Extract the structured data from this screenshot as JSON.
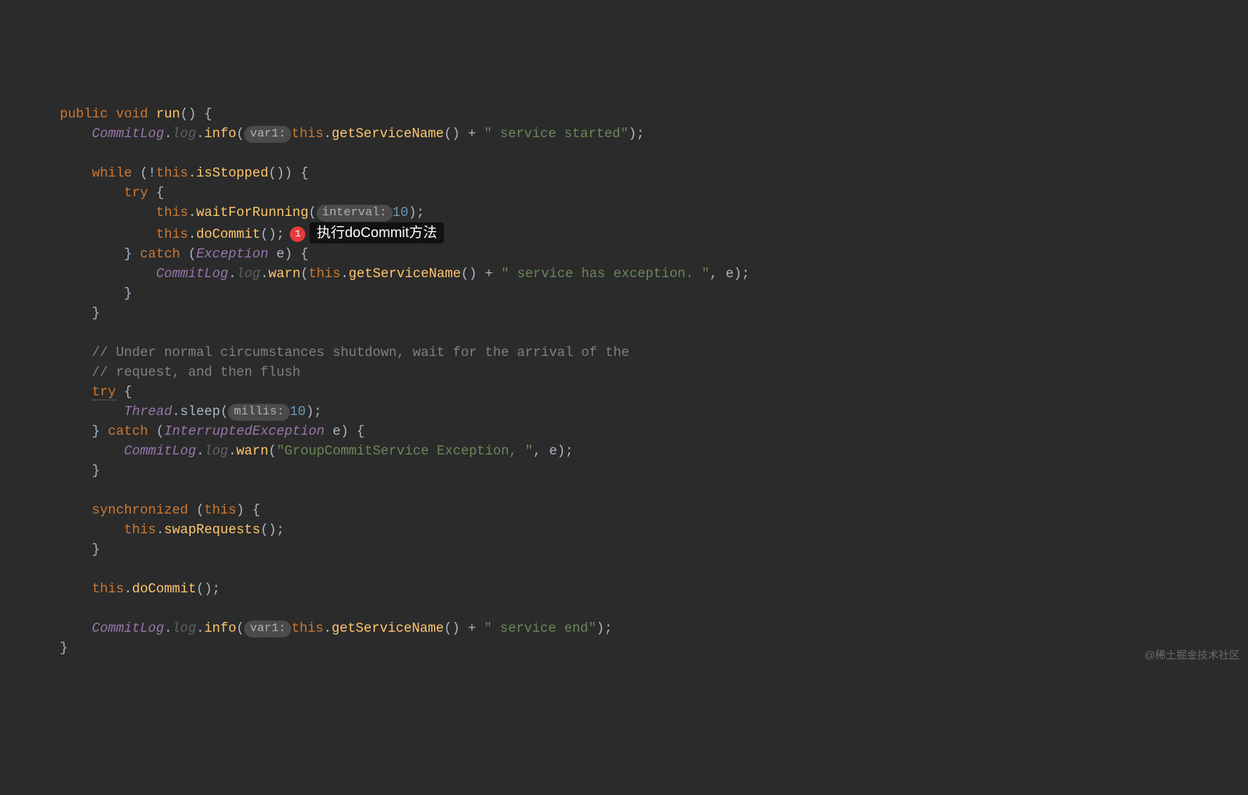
{
  "code": {
    "kw_public": "public",
    "kw_void": "void",
    "kw_while": "while",
    "kw_try": "try",
    "kw_catch": "catch",
    "kw_this": "this",
    "kw_synchronized": "synchronized",
    "method_run": "run",
    "cls_CommitLog": "CommitLog",
    "field_log": "log",
    "method_info": "info",
    "method_warn": "warn",
    "hint_var1": "var1:",
    "hint_interval": "interval:",
    "hint_millis": "millis:",
    "method_getServiceName": "getServiceName",
    "str_service_started": "\" service started\"",
    "method_isStopped": "isStopped",
    "method_waitForRunning": "waitForRunning",
    "num_10": "10",
    "method_doCommit": "doCommit",
    "badge_1": "1",
    "annotation_text": "执行doCommit方法",
    "cls_Exception": "Exception",
    "var_e": "e",
    "str_service_exception": "\" service has exception. \"",
    "comment1": "// Under normal circumstances shutdown, wait for the arrival of the",
    "comment2": "// request, and then flush",
    "cls_Thread": "Thread",
    "method_sleep": "sleep",
    "cls_InterruptedException": "InterruptedException",
    "str_group_commit_exc": "\"GroupCommitService Exception, \"",
    "method_swapRequests": "swapRequests",
    "str_service_end": "\" service end\""
  },
  "watermark": "@稀土掘金技术社区"
}
